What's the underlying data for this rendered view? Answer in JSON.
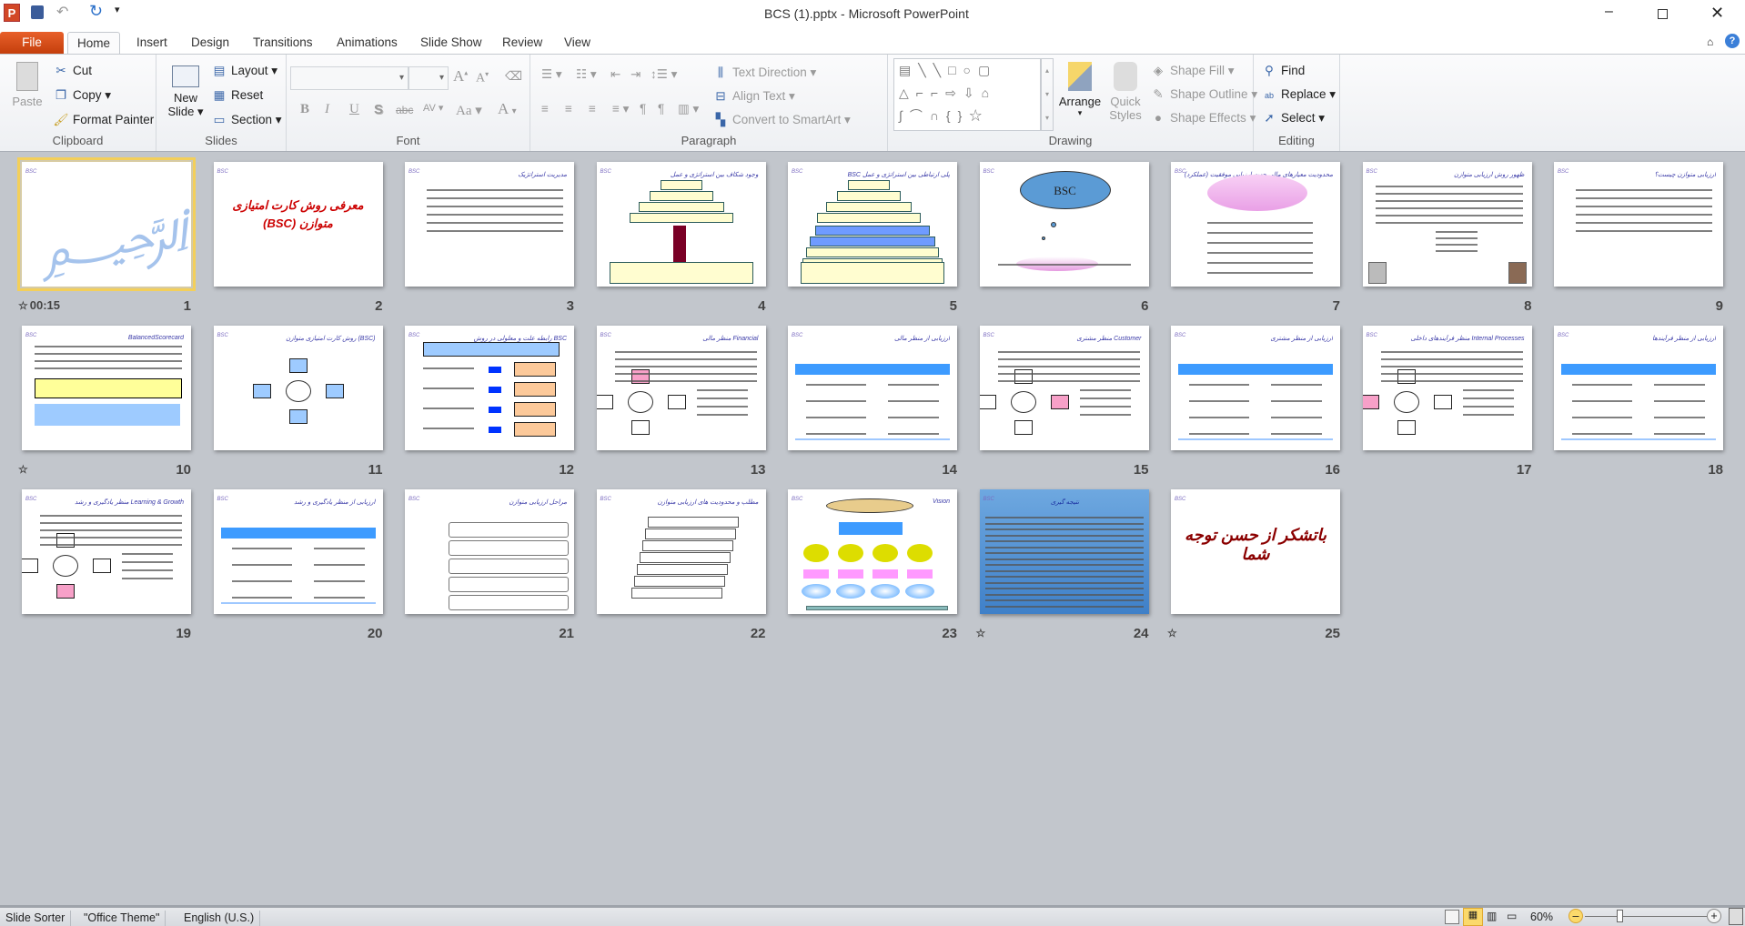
{
  "window": {
    "title": "BCS (1).pptx - Microsoft PowerPoint",
    "app_icon": "P",
    "controls": [
      "minimize",
      "restore",
      "close"
    ]
  },
  "quick_access": [
    "save-icon",
    "undo-icon",
    "redo-icon",
    "customize-icon"
  ],
  "tabs": [
    {
      "label": "File"
    },
    {
      "label": "Home"
    },
    {
      "label": "Insert"
    },
    {
      "label": "Design"
    },
    {
      "label": "Transitions"
    },
    {
      "label": "Animations"
    },
    {
      "label": "Slide Show"
    },
    {
      "label": "Review"
    },
    {
      "label": "View"
    }
  ],
  "ribbon": {
    "clipboard": {
      "label": "Clipboard",
      "paste": "Paste",
      "cut": "Cut",
      "copy": "Copy",
      "format_painter": "Format Painter"
    },
    "slides": {
      "label": "Slides",
      "new_slide_1": "New",
      "new_slide_2": "Slide",
      "layout": "Layout",
      "reset": "Reset",
      "section": "Section"
    },
    "font": {
      "label": "Font",
      "font_name": "",
      "font_size": "",
      "bold": "B",
      "italic": "I",
      "underline": "U",
      "shadow": "S",
      "strike": "abc",
      "spacing": "AV",
      "case": "Aa",
      "color": "A"
    },
    "paragraph": {
      "label": "Paragraph",
      "text_direction": "Text Direction",
      "align_text": "Align Text",
      "convert_smartart": "Convert to SmartArt"
    },
    "drawing": {
      "label": "Drawing",
      "arrange": "Arrange",
      "quick_styles_1": "Quick",
      "quick_styles_2": "Styles",
      "shape_fill": "Shape Fill",
      "shape_outline": "Shape Outline",
      "shape_effects": "Shape Effects"
    },
    "editing": {
      "label": "Editing",
      "find": "Find",
      "replace": "Replace",
      "select": "Select"
    }
  },
  "slides": [
    {
      "num": "1",
      "kind": "bismillah",
      "title": "",
      "badge": "00:15",
      "selected": true
    },
    {
      "num": "2",
      "kind": "title-red",
      "title": "معرفی روش کارت امتیازی متوازن (BSC)"
    },
    {
      "num": "3",
      "kind": "text",
      "title": "مدیریت استراتژیک"
    },
    {
      "num": "4",
      "kind": "pyramid",
      "title": "وجود شکاف بین استراتژی و عمل"
    },
    {
      "num": "5",
      "kind": "pyramid",
      "title": "BSC پلی ارتباطی بین استراتژی و عمل"
    },
    {
      "num": "6",
      "kind": "cloud",
      "title": "BSC"
    },
    {
      "num": "7",
      "kind": "ellipse-text",
      "title": "محدودیت معیارهای مالی جهت ارزیابی موفقیت (عملکرد)"
    },
    {
      "num": "8",
      "kind": "text-photos",
      "title": "ظهور روش ارزیابی متوازن"
    },
    {
      "num": "9",
      "kind": "text",
      "title": "ارزیابی متوازن چیست؟"
    },
    {
      "num": "10",
      "kind": "text-boxes",
      "title": "BalancedScorecard",
      "badge": "star"
    },
    {
      "num": "11",
      "kind": "diagram",
      "title": "روش کارت امتیازی متوازن (BSC)"
    },
    {
      "num": "12",
      "kind": "arrows",
      "title": "رابطه علت و معلولی در روش BSC"
    },
    {
      "num": "13",
      "kind": "diagram-list",
      "title": "منظر مالی Financial"
    },
    {
      "num": "14",
      "kind": "table",
      "title": "ارزیابی از منظر مالی"
    },
    {
      "num": "15",
      "kind": "diagram-list",
      "title": "منظر مشتری Customer"
    },
    {
      "num": "16",
      "kind": "table",
      "title": "ارزیابی از منظر مشتری"
    },
    {
      "num": "17",
      "kind": "diagram-list",
      "title": "منظر فرآیندهای داخلی Internal Processes"
    },
    {
      "num": "18",
      "kind": "table",
      "title": "ارزیابی از منظر فرآیندها"
    },
    {
      "num": "19",
      "kind": "diagram-list",
      "title": "منظر یادگیری و رشد Learning & Growth"
    },
    {
      "num": "20",
      "kind": "table",
      "title": "ارزیابی از منظر یادگیری و رشد"
    },
    {
      "num": "21",
      "kind": "boxes",
      "title": "مراحل ارزیابی متوازن"
    },
    {
      "num": "22",
      "kind": "stack",
      "title": "مطلب و محدودیت های ارزیابی متوازن"
    },
    {
      "num": "23",
      "kind": "flow",
      "title": "Vision"
    },
    {
      "num": "24",
      "kind": "blue-text",
      "title": "نتیجه گیری",
      "badge": "star"
    },
    {
      "num": "25",
      "kind": "thanks",
      "title": "باتشکر از حسن توجه شما",
      "badge": "star"
    }
  ],
  "slide_tag": "BSC",
  "status": {
    "view": "Slide Sorter",
    "theme": "\"Office Theme\"",
    "language": "English (U.S.)",
    "zoom": "60%",
    "zoom_level_percent": 60
  },
  "colors": {
    "file_tab": "#d5461a",
    "selection": "#f3cf5a",
    "table_header": "#3d9bff",
    "slide_title": "#3a3aa8"
  }
}
